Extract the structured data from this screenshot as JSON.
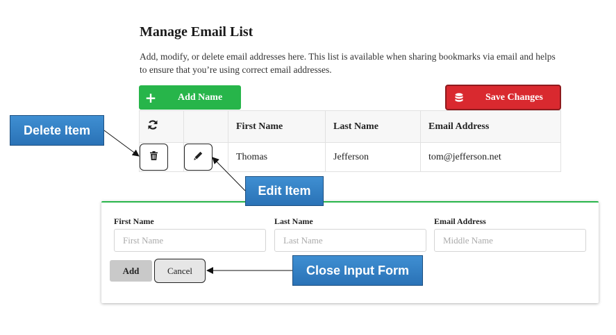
{
  "page": {
    "title": "Manage Email List",
    "description": "Add, modify, or delete email addresses here. This list is available when sharing bookmarks via email and helps to ensure that you’re using correct email addresses."
  },
  "toolbar": {
    "add_name_label": "Add Name",
    "add_name_icon": "plus-icon",
    "save_label": "Save Changes",
    "save_icon": "database-icon"
  },
  "table": {
    "refresh_icon": "refresh-icon",
    "columns": [
      "First Name",
      "Last Name",
      "Email Address"
    ],
    "rows": [
      {
        "first": "Thomas",
        "last": "Jefferson",
        "email": "tom@jefferson.net"
      }
    ]
  },
  "form": {
    "fields": [
      {
        "label": "First Name",
        "placeholder": "First Name"
      },
      {
        "label": "Last Name",
        "placeholder": "Last Name"
      },
      {
        "label": "Email Address",
        "placeholder": "Middle Name"
      }
    ],
    "add_label": "Add",
    "cancel_label": "Cancel"
  },
  "callouts": {
    "delete": "Delete Item",
    "edit": "Edit Item",
    "close": "Close Input Form"
  },
  "colors": {
    "add_green": "#27b54a",
    "save_red": "#d9292f",
    "callout_blue": "#2f7dc4"
  }
}
